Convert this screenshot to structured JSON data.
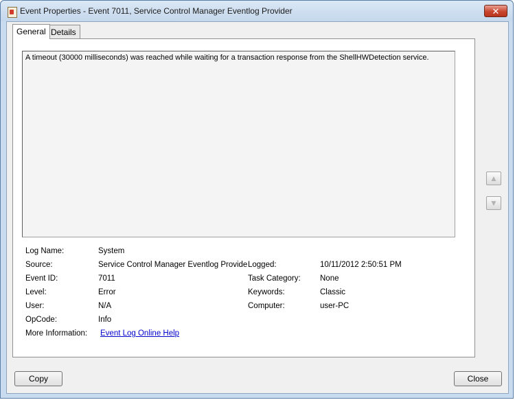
{
  "window": {
    "title": "Event Properties - Event 7011, Service Control Manager Eventlog Provider",
    "close_glyph": "✕",
    "icon": "event-viewer-icon"
  },
  "tabs": [
    {
      "label": "General",
      "active": true
    },
    {
      "label": "Details",
      "active": false
    }
  ],
  "description": "A timeout (30000 milliseconds) was reached while waiting for a transaction response from the ShellHWDetection service.",
  "fields": {
    "log_name": {
      "label": "Log Name:",
      "value": "System"
    },
    "source": {
      "label": "Source:",
      "value": "Service Control Manager Eventlog Provide"
    },
    "logged": {
      "label": "Logged:",
      "value": "10/11/2012 2:50:51 PM"
    },
    "event_id": {
      "label": "Event ID:",
      "value": "7011"
    },
    "task_category": {
      "label": "Task Category:",
      "value": "None"
    },
    "level": {
      "label": "Level:",
      "value": "Error"
    },
    "keywords": {
      "label": "Keywords:",
      "value": "Classic"
    },
    "user": {
      "label": "User:",
      "value": "N/A"
    },
    "computer": {
      "label": "Computer:",
      "value": "user-PC"
    },
    "opcode": {
      "label": "OpCode:",
      "value": "Info"
    },
    "more_info": {
      "label": "More Information:",
      "link": "Event Log Online Help"
    }
  },
  "nav": {
    "up_glyph": "▲",
    "down_glyph": "▼"
  },
  "buttons": {
    "copy": "Copy",
    "close": "Close"
  },
  "colors": {
    "link": "#0000cc",
    "title_bar": "#c9dcef",
    "close_button": "#c8462e"
  }
}
